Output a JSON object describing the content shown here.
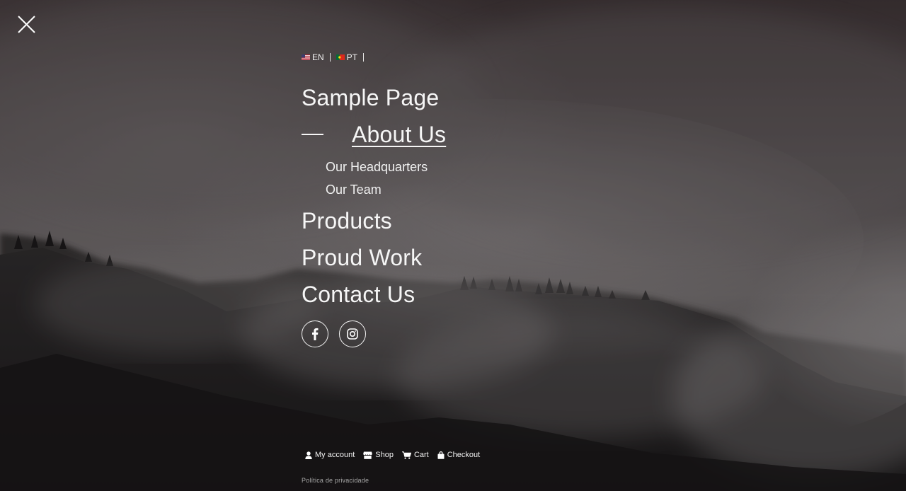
{
  "languages": [
    {
      "code": "EN",
      "flag": "us-flag-icon"
    },
    {
      "code": "PT",
      "flag": "pt-flag-icon"
    }
  ],
  "menu": {
    "items": [
      {
        "label": "Sample Page"
      },
      {
        "label": "About Us",
        "active": true
      },
      {
        "label": "Products"
      },
      {
        "label": "Proud Work"
      },
      {
        "label": "Contact Us"
      }
    ],
    "about_submenu": [
      {
        "label": "Our Headquarters"
      },
      {
        "label": "Our Team"
      }
    ]
  },
  "social": [
    {
      "name": "facebook",
      "icon": "facebook-icon"
    },
    {
      "name": "instagram",
      "icon": "instagram-icon"
    }
  ],
  "footer": {
    "links": [
      {
        "label": "My account",
        "icon": "user-icon"
      },
      {
        "label": "Shop",
        "icon": "store-icon"
      },
      {
        "label": "Cart",
        "icon": "cart-icon"
      },
      {
        "label": "Checkout",
        "icon": "bag-icon"
      }
    ],
    "privacy": "Política de privacidade"
  },
  "colors": {
    "text": "#f6f6f6",
    "overlay_dark": "#2b2527",
    "fog": "#8a8587"
  }
}
